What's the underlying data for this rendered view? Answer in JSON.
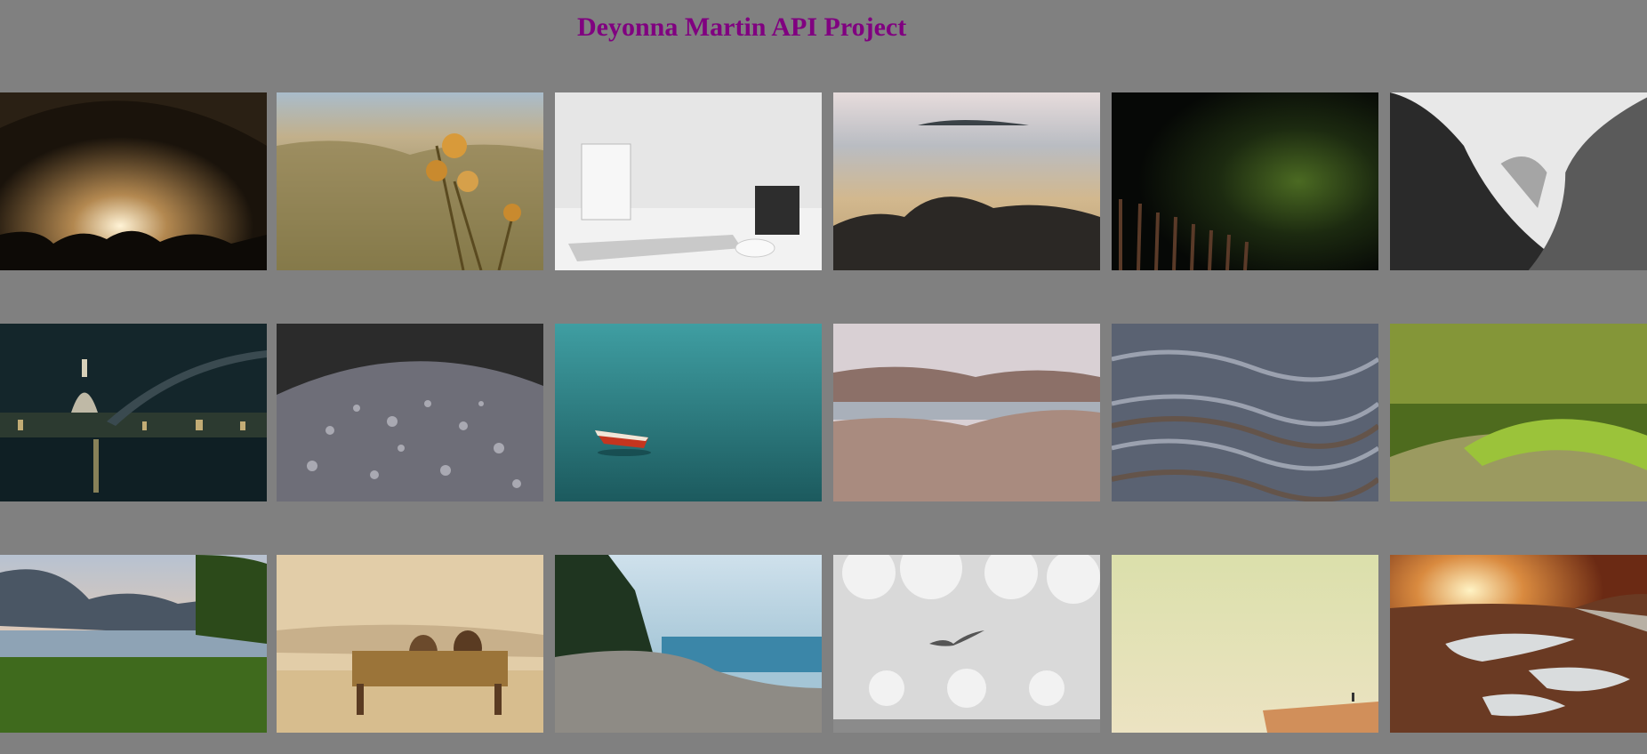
{
  "header": {
    "title": "Deyonna Martin API Project"
  },
  "gallery": {
    "photos": [
      {
        "subject": "concert-crowd"
      },
      {
        "subject": "thistle-valley"
      },
      {
        "subject": "laptop-desk"
      },
      {
        "subject": "rocky-beach"
      },
      {
        "subject": "night-sky-fence"
      },
      {
        "subject": "misty-mountains"
      },
      {
        "subject": "city-night-river"
      },
      {
        "subject": "water-droplets"
      },
      {
        "subject": "red-boat-teal-sea"
      },
      {
        "subject": "lake-dry-grass"
      },
      {
        "subject": "flowing-water"
      },
      {
        "subject": "green-forest-moss"
      },
      {
        "subject": "lake-mountains-reeds"
      },
      {
        "subject": "couple-on-bench"
      },
      {
        "subject": "pebble-shore"
      },
      {
        "subject": "seagull-cloudy-sky"
      },
      {
        "subject": "pale-yellow-horizon"
      },
      {
        "subject": "sunset-road-puddles"
      }
    ]
  }
}
